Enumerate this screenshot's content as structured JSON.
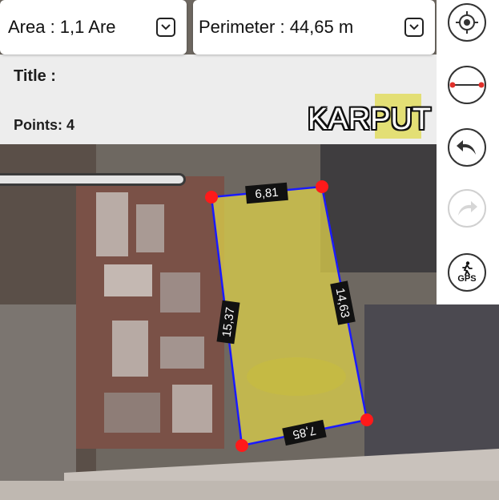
{
  "header": {
    "area_text": "Area : 1,1 Are",
    "perimeter_text": "Perimeter : 44,65 m"
  },
  "info": {
    "title_label": "Title :",
    "points_label": "Points: 4"
  },
  "brand": "KARPUT",
  "toolbar": {
    "gps_label": "GPS"
  },
  "edges": {
    "top": "6,81",
    "right": "14,63",
    "bottom": "7,85",
    "left": "15,37"
  },
  "colors": {
    "polygon_fill": "#d8cc4a",
    "polygon_stroke": "#1a1aff",
    "vertex": "#ff1a1a"
  },
  "icons": [
    "locate-icon",
    "ruler-icon",
    "undo-icon",
    "redo-icon",
    "gps-walk-icon",
    "chevron-down-icon"
  ]
}
